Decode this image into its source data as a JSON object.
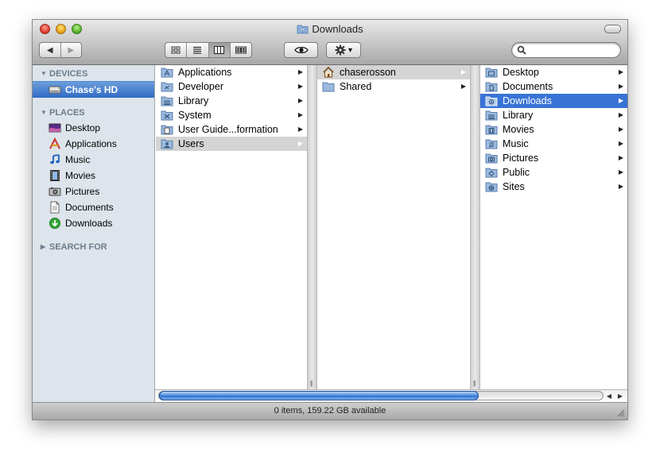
{
  "window": {
    "title": "Downloads"
  },
  "toolbar": {
    "back_glyph": "◀",
    "forward_glyph": "▶",
    "views": [
      "icon-view",
      "list-view",
      "column-view",
      "coverflow-view"
    ],
    "active_view": "column-view",
    "quicklook_icon": "eye-icon",
    "action_icon": "gear-icon",
    "action_caret": "▾",
    "search_placeholder": "",
    "search_value": ""
  },
  "sidebar": {
    "devices_header": "DEVICES",
    "devices": [
      {
        "label": "Chase's HD",
        "icon": "hard-drive-icon"
      }
    ],
    "places_header": "PLACES",
    "places": [
      {
        "label": "Desktop",
        "icon": "desktop-icon"
      },
      {
        "label": "Applications",
        "icon": "applications-icon"
      },
      {
        "label": "Music",
        "icon": "music-icon"
      },
      {
        "label": "Movies",
        "icon": "movies-icon"
      },
      {
        "label": "Pictures",
        "icon": "pictures-icon"
      },
      {
        "label": "Documents",
        "icon": "documents-icon"
      },
      {
        "label": "Downloads",
        "icon": "downloads-icon"
      }
    ],
    "search_header": "SEARCH FOR"
  },
  "columns": {
    "col1": [
      {
        "label": "Applications",
        "icon": "applications-folder-icon"
      },
      {
        "label": "Developer",
        "icon": "developer-folder-icon"
      },
      {
        "label": "Library",
        "icon": "library-folder-icon"
      },
      {
        "label": "System",
        "icon": "system-folder-icon"
      },
      {
        "label": "User Guide...formation",
        "icon": "document-folder-icon"
      },
      {
        "label": "Users",
        "icon": "users-folder-icon"
      }
    ],
    "col2": [
      {
        "label": "chaserosson",
        "icon": "home-icon"
      },
      {
        "label": "Shared",
        "icon": "folder-icon"
      }
    ],
    "col3": [
      {
        "label": "Desktop",
        "icon": "desktop-folder-icon"
      },
      {
        "label": "Documents",
        "icon": "documents-folder-icon"
      },
      {
        "label": "Downloads",
        "icon": "downloads-folder-icon"
      },
      {
        "label": "Library",
        "icon": "library-folder-icon"
      },
      {
        "label": "Movies",
        "icon": "movies-folder-icon"
      },
      {
        "label": "Music",
        "icon": "music-folder-icon"
      },
      {
        "label": "Pictures",
        "icon": "pictures-folder-icon"
      },
      {
        "label": "Public",
        "icon": "public-folder-icon"
      },
      {
        "label": "Sites",
        "icon": "sites-folder-icon"
      }
    ],
    "arrow_glyph": "▶"
  },
  "scrollbar": {
    "position_fraction": 0.72,
    "arrow_left": "◀",
    "arrow_right": "▶"
  },
  "status": {
    "text": "0 items, 159.22 GB available"
  },
  "colors": {
    "selection_blue": "#3873d6",
    "sidebar_bg": "#dde4eb",
    "path_gray": "#d4d4d4"
  }
}
